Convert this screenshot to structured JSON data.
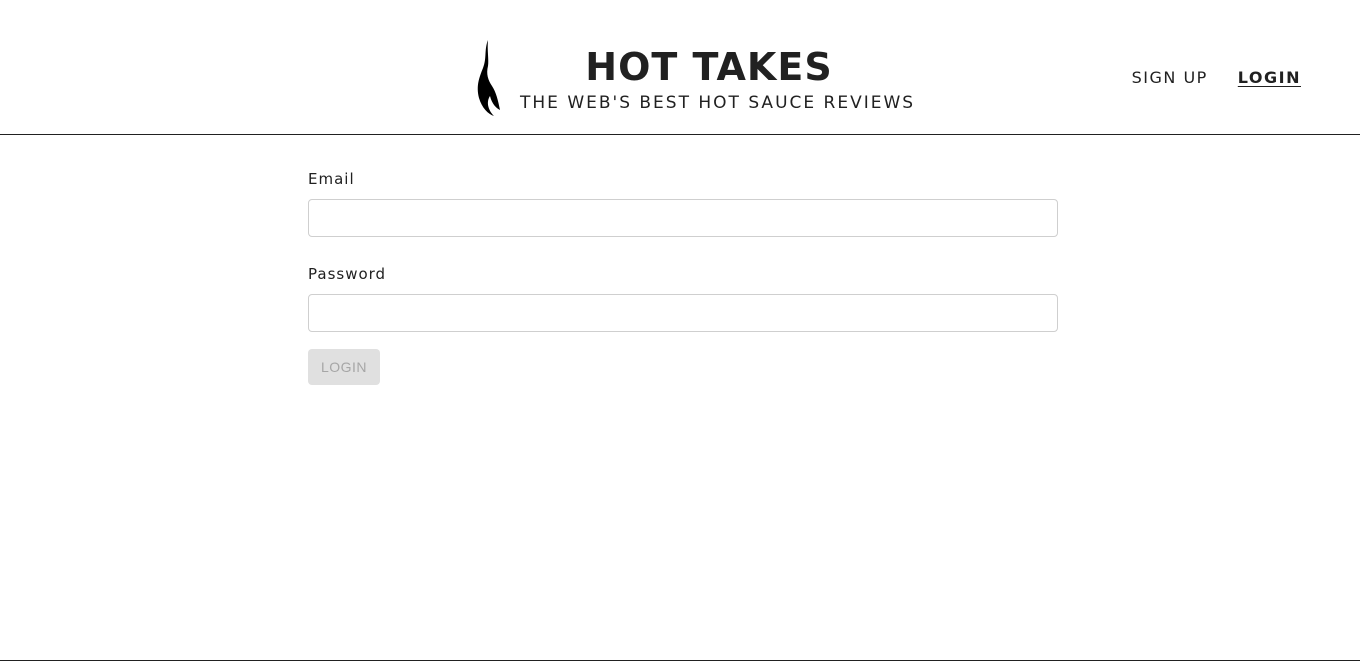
{
  "header": {
    "title": "HOT TAKES",
    "subtitle": "THE WEB'S BEST HOT SAUCE REVIEWS",
    "logo_icon": "flame-icon"
  },
  "nav": {
    "items": [
      {
        "label": "SIGN UP",
        "active": false
      },
      {
        "label": "LOGIN",
        "active": true
      }
    ]
  },
  "form": {
    "email": {
      "label": "Email",
      "value": "",
      "placeholder": ""
    },
    "password": {
      "label": "Password",
      "value": "",
      "placeholder": ""
    },
    "submit": {
      "label": "LOGIN",
      "disabled": true
    }
  },
  "colors": {
    "text": "#212121",
    "input_border": "#cfcfcf",
    "button_disabled_bg": "#e0e0e0",
    "button_disabled_text": "#a6a6a6"
  }
}
